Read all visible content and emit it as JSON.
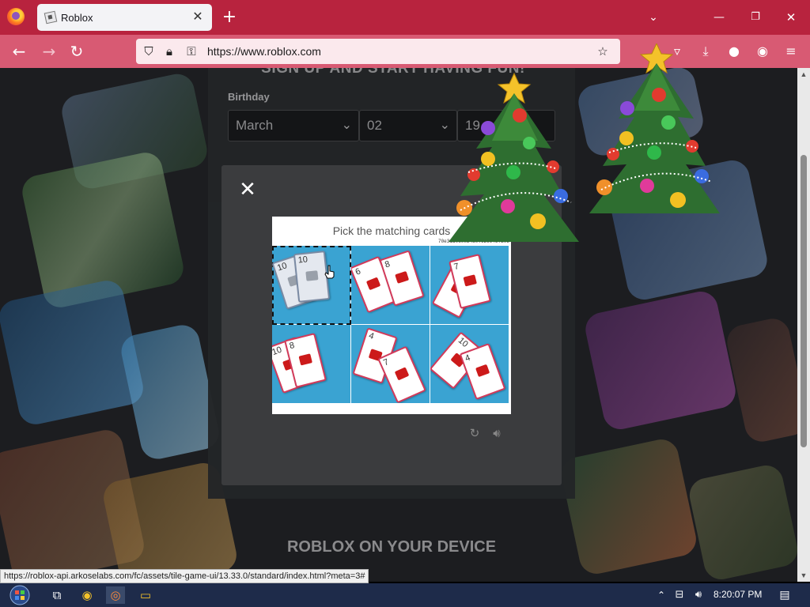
{
  "browser": {
    "tab_title": "Roblox",
    "tab_close": "✕",
    "new_tab": "+",
    "url": "https://www.roblox.com",
    "status_url": "https://roblox-api.arkoselabs.com/fc/assets/tile-game-ui/13.33.0/standard/index.html?meta=3#"
  },
  "signup": {
    "heading": "SIGN UP AND START HAVING FUN!",
    "birthday_label": "Birthday",
    "month": "March",
    "day": "02",
    "year": "19"
  },
  "captcha": {
    "title": "Pick the matching cards",
    "session_id": "70e31d0c0e24b0.6299457205",
    "close_label": "✕",
    "tiles": [
      {
        "cards": [
          "10",
          "10"
        ],
        "style": "grey",
        "selected": true
      },
      {
        "cards": [
          "6",
          "8"
        ],
        "style": "red",
        "selected": false
      },
      {
        "cards": [
          "4",
          "7"
        ],
        "style": "red",
        "selected": false
      },
      {
        "cards": [
          "10",
          "8"
        ],
        "style": "red",
        "selected": false
      },
      {
        "cards": [
          "4",
          "7"
        ],
        "style": "red",
        "selected": false
      },
      {
        "cards": [
          "10",
          "4"
        ],
        "style": "red",
        "selected": false
      }
    ]
  },
  "footer": {
    "device_heading": "ROBLOX ON YOUR DEVICE"
  },
  "taskbar": {
    "clock": "8:20:07 PM"
  },
  "icons": {
    "back": "back-arrow-icon",
    "forward": "forward-arrow-icon",
    "reload": "reload-icon",
    "shield": "shield-icon",
    "lock": "lock-icon",
    "permissions": "key-icon",
    "bookmark": "star-icon",
    "pocket": "pocket-icon",
    "downloads": "download-icon",
    "menu": "hamburger-icon",
    "refresh_captcha": "refresh-icon",
    "audio_captcha": "speaker-icon"
  }
}
